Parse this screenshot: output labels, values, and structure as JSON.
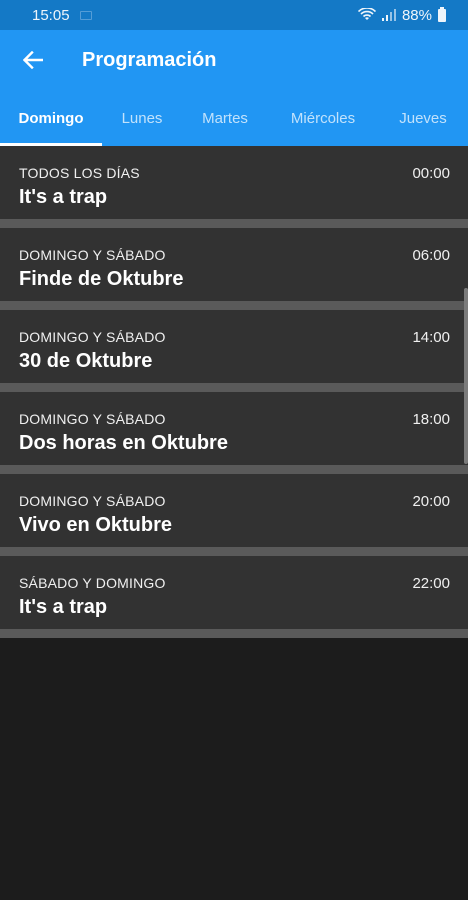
{
  "status_bar": {
    "time": "15:05",
    "battery": "88%"
  },
  "app_bar": {
    "title": "Programación",
    "back_icon": "arrow-left-icon"
  },
  "tabs": [
    {
      "label": "Domingo",
      "active": true
    },
    {
      "label": "Lunes",
      "active": false
    },
    {
      "label": "Martes",
      "active": false
    },
    {
      "label": "Miércoles",
      "active": false
    },
    {
      "label": "Jueves",
      "active": false
    }
  ],
  "schedule": [
    {
      "days": "TODOS LOS DÍAS",
      "time": "00:00",
      "title": "It's a trap"
    },
    {
      "days": "DOMINGO Y SÁBADO",
      "time": "06:00",
      "title": "Finde de Oktubre"
    },
    {
      "days": "DOMINGO Y SÁBADO",
      "time": "14:00",
      "title": "30 de Oktubre"
    },
    {
      "days": "DOMINGO Y SÁBADO",
      "time": "18:00",
      "title": "Dos horas en Oktubre"
    },
    {
      "days": "DOMINGO Y SÁBADO",
      "time": "20:00",
      "title": "Vivo en Oktubre"
    },
    {
      "days": "SÁBADO Y DOMINGO",
      "time": "22:00",
      "title": "It's a trap"
    }
  ],
  "colors": {
    "primary": "#2196f3",
    "status_bar": "#1479c6",
    "row_background": "#323232",
    "row_separator": "#5a5a5a",
    "page_background": "#1c1c1c"
  }
}
